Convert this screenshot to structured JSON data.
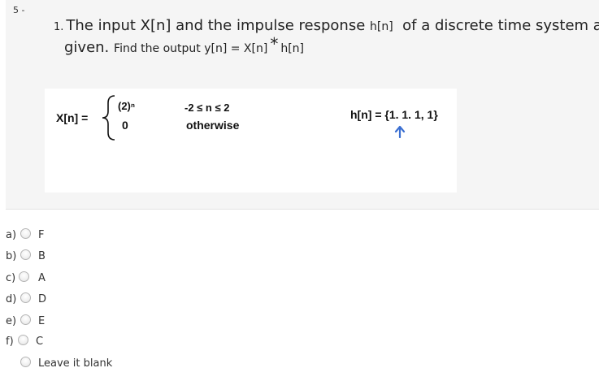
{
  "question": {
    "number": "5 -",
    "enum": "1.",
    "text_part1": "The input X[n] and the impulse response",
    "hn_inline": "h[n]",
    "text_part2": "of a discrete time system are",
    "text_part3": "given.",
    "find_text": "Find the output y[n] = X[n]",
    "star": "*",
    "hn_end": "h[n]"
  },
  "figure": {
    "xn_label": "X[n] =",
    "case1_expr": "(2)ⁿ",
    "case2_expr": "0",
    "case1_cond": "-2 ≤  n  ≤  2",
    "case2_cond": "otherwise",
    "hn_def": "h[n] = {1. 1. 1, 1}",
    "arrow_color": "#3b6fd1"
  },
  "options": [
    {
      "letter": "a)",
      "label": "F"
    },
    {
      "letter": "b)",
      "label": "B"
    },
    {
      "letter": "c)",
      "label": "A"
    },
    {
      "letter": "d)",
      "label": "D"
    },
    {
      "letter": "e)",
      "label": "E"
    },
    {
      "letter": "f)",
      "label": "C"
    },
    {
      "letter": "",
      "label": "Leave it blank"
    }
  ]
}
